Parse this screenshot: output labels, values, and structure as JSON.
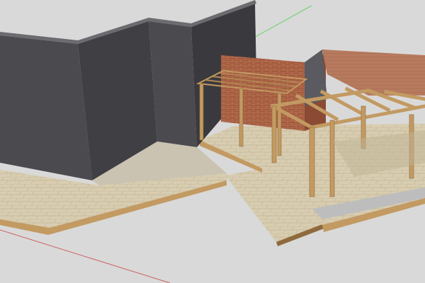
{
  "scene": {
    "description_visible_text": "",
    "colors": {
      "background": "#d9d9d9",
      "wall_dark": "#4a4a4f",
      "wall_side": "#3a3a3e",
      "wall_top": "#6b6b70",
      "paving": "#d8cdb0",
      "paving_shade": "#bfb496",
      "timber": "#c29a62",
      "timber_dark": "#8f6a3c",
      "brick": "#a35a3e",
      "brick_light": "#c98a68",
      "roof_brick": "#b77a5e",
      "gravel": "#bdbdbd",
      "axis_green": "#6fd16f",
      "axis_red": "#d06060"
    },
    "icons": [
      "axis-green-line",
      "axis-red-line"
    ]
  }
}
